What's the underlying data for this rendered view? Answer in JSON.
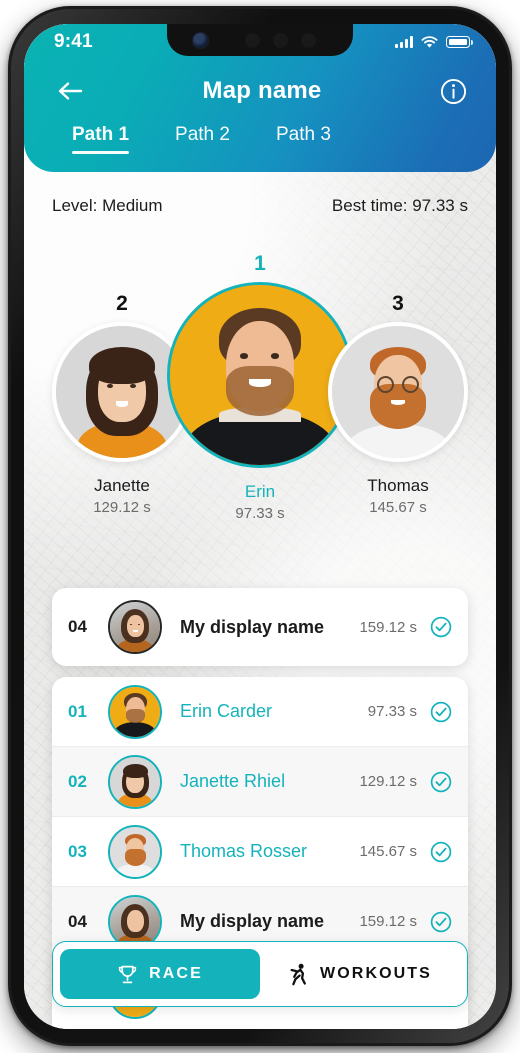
{
  "status_bar": {
    "time": "9:41",
    "signal_icon": "signal-bars-icon",
    "wifi_icon": "wifi-icon",
    "battery_icon": "battery-icon"
  },
  "header": {
    "back_icon": "back-arrow-icon",
    "title": "Map name",
    "info_icon": "info-circle-icon",
    "gradient_from": "#0ab3b4",
    "gradient_to": "#1d66b2",
    "tabs": [
      {
        "label": "Path 1",
        "active": true
      },
      {
        "label": "Path 2",
        "active": false
      },
      {
        "label": "Path 3",
        "active": false
      }
    ]
  },
  "meta": {
    "level": "Level: Medium",
    "best_time": "Best time: 97.33 s"
  },
  "podium": {
    "accent_color": "#14b3bc",
    "first_bg_color": "#efac15",
    "entries": [
      {
        "rank": "2",
        "name": "Janette",
        "time": "129.12 s",
        "highlight": false
      },
      {
        "rank": "1",
        "name": "Erin",
        "time": "97.33 s",
        "highlight": true
      },
      {
        "rank": "3",
        "name": "Thomas",
        "time": "145.67 s",
        "highlight": false
      }
    ]
  },
  "leaderboard": {
    "pinned": {
      "rank": "04",
      "name": "My display name",
      "time": "159.12 s",
      "status_icon": "check-circle-icon",
      "is_me": true
    },
    "rows": [
      {
        "rank": "01",
        "name": "Erin Carder",
        "time": "97.33 s",
        "status_icon": "check-circle-icon",
        "is_me": false
      },
      {
        "rank": "02",
        "name": "Janette Rhiel",
        "time": "129.12 s",
        "status_icon": "check-circle-icon",
        "is_me": false
      },
      {
        "rank": "03",
        "name": "Thomas Rosser",
        "time": "145.67 s",
        "status_icon": "check-circle-icon",
        "is_me": false
      },
      {
        "rank": "04",
        "name": "My display name",
        "time": "159.12 s",
        "status_icon": "check-circle-icon",
        "is_me": true
      }
    ]
  },
  "tab_bar": {
    "race": {
      "label": "RACE",
      "icon": "trophy-icon",
      "active": true
    },
    "workouts": {
      "label": "WORKOUTS",
      "icon": "running-person-icon",
      "active": false
    }
  }
}
